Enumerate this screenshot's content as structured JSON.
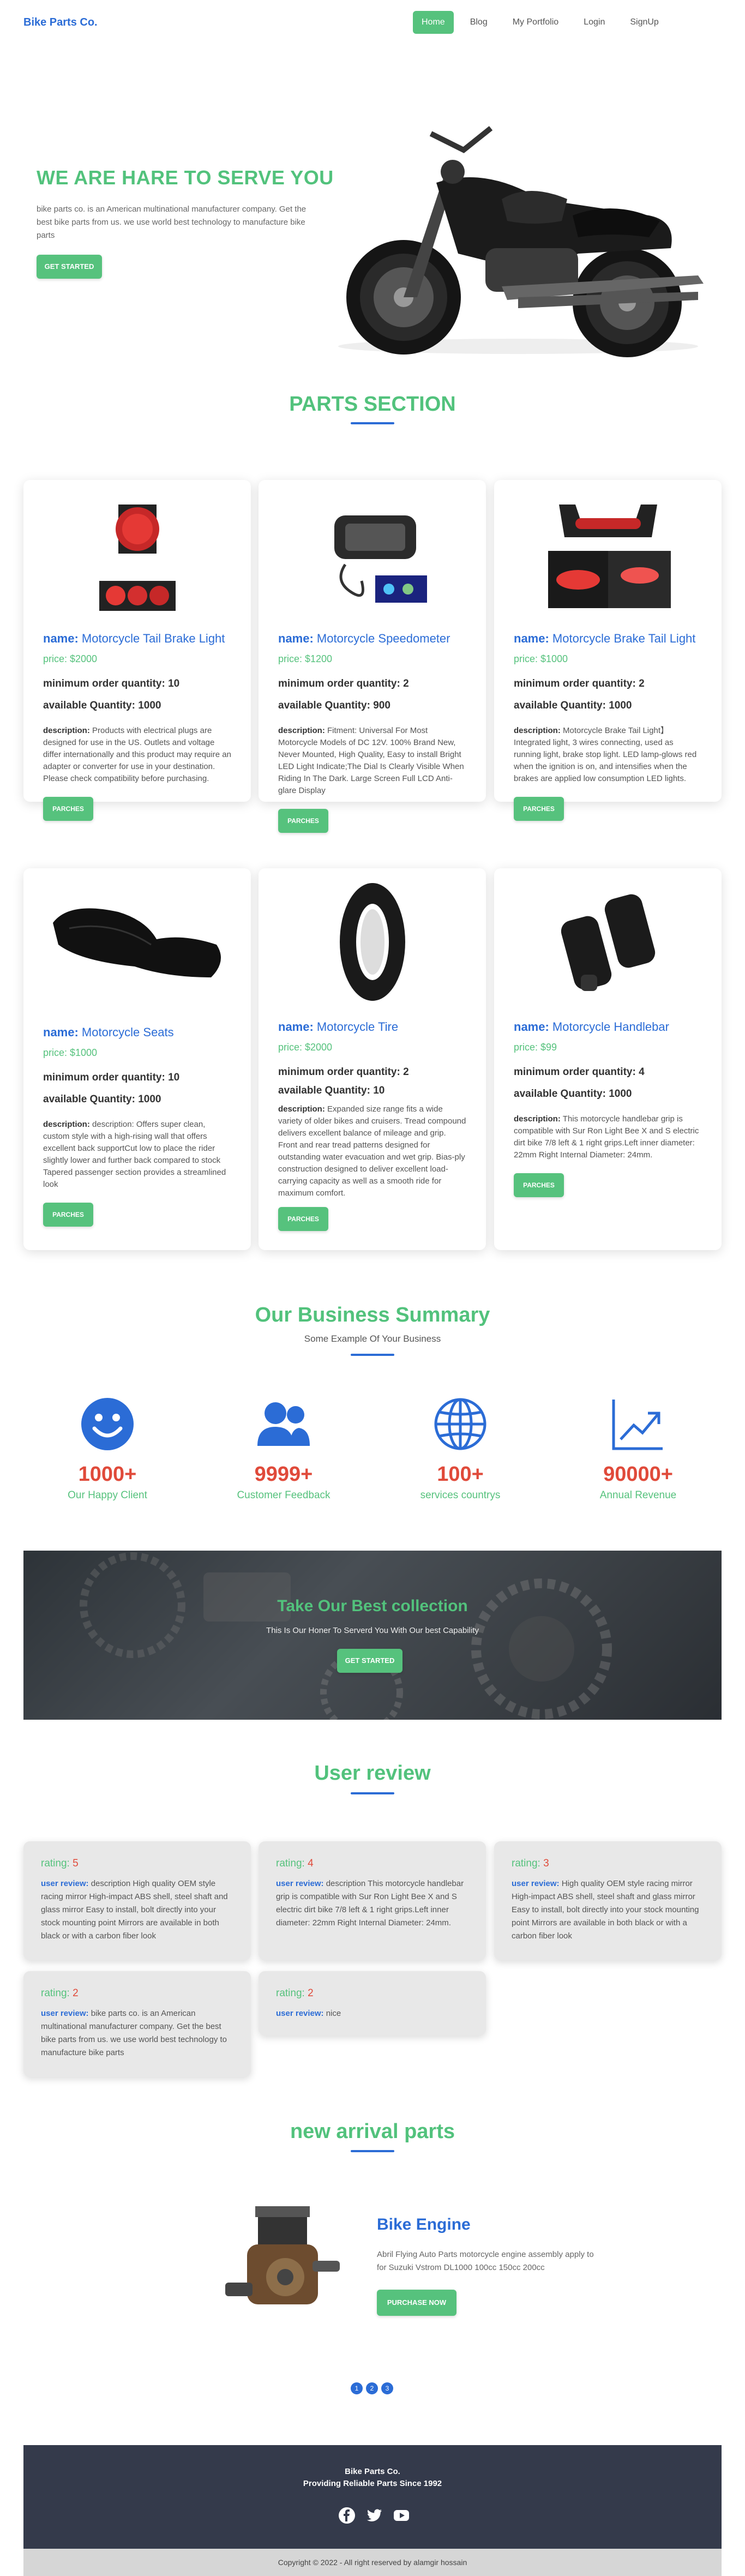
{
  "nav": {
    "brand": "Bike Parts Co.",
    "links": [
      "Home",
      "Blog",
      "My Portfolio",
      "Login",
      "SignUp"
    ]
  },
  "hero": {
    "title": "WE ARE HARE TO SERVE YOU",
    "text": "bike parts co. is an American multinational manufacturer company. Get the best bike parts from us. we use world best technology to manufacture bike parts",
    "button": "GET STARTED"
  },
  "parts": {
    "title": "PARTS SECTION",
    "name_label": "name:",
    "min_label": "minimum order quantity:",
    "avail_label": "available Quantity:",
    "desc_label": "description:",
    "button": "PARCHES",
    "items": [
      {
        "name": "Motorcycle Tail Brake Light",
        "price": "price: $2000",
        "min": "10",
        "avail": "1000",
        "desc": "Products with electrical plugs are designed for use in the US. Outlets and voltage differ internationally and this product may require an adapter or converter for use in your destination. Please check compatibility before purchasing."
      },
      {
        "name": "Motorcycle Speedometer",
        "price": "price: $1200",
        "min": "2",
        "avail": "900",
        "desc": "Fitment:  Universal For Most Motorcycle Models of DC 12V. 100% Brand New, Never Mounted, High Quality,  Easy to install Bright LED Light Indicate;The Dial Is Clearly Visible When Riding In The Dark. Large Screen Full LCD Anti-glare Display"
      },
      {
        "name": "Motorcycle Brake Tail Light",
        "price": "price: $1000",
        "min": "2",
        "avail": "1000",
        "desc": "Motorcycle Brake Tail Light】Integrated light, 3 wires connecting, used as running light, brake stop light. LED lamp-glows red when the ignition is on, and intensifies when the brakes are applied low consumption LED lights."
      },
      {
        "name": "Motorcycle Seats",
        "price": "price: $1000",
        "min": "10",
        "avail": "1000",
        "desc": "description: Offers super clean, custom style with a high-rising wall that offers excellent back supportCut low to place the rider slightly lower and further back compared to stock Tapered passenger section provides a streamlined look"
      },
      {
        "name": "Motorcycle Tire",
        "price": "price: $2000",
        "min": "2",
        "avail": "10",
        "desc": "Expanded size range fits a wide variety of older bikes and cruisers. Tread compound delivers excellent balance of mileage and grip. Front and rear tread patterns designed for outstanding water evacuation and wet grip. Bias-ply construction designed to deliver excellent load-carrying capacity as well as a smooth ride for maximum comfort."
      },
      {
        "name": "Motorcycle Handlebar",
        "price": "price: $99",
        "min": "4",
        "avail": "1000",
        "desc": "This motorcycle handlebar grip is compatible with Sur Ron Light Bee X and S electric dirt bike 7/8 left & 1 right grips.Left inner diameter: 22mm Right Internal Diameter: 24mm."
      }
    ]
  },
  "summary": {
    "title": "Our Business Summary",
    "subtitle": "Some Example Of Your Business",
    "stats": [
      {
        "num": "1000+",
        "label": "Our Happy Client",
        "icon": "smiley-icon"
      },
      {
        "num": "9999+",
        "label": "Customer Feedback",
        "icon": "users-icon"
      },
      {
        "num": "100+",
        "label": "services countrys",
        "icon": "globe-icon"
      },
      {
        "num": "90000+",
        "label": "Annual Revenue",
        "icon": "trending-up-icon"
      }
    ]
  },
  "banner": {
    "title": "Take Our Best collection",
    "text": "This Is Our Honer To Serverd You With Our best Capability",
    "button": "GET STARTED"
  },
  "reviews": {
    "title": "User review",
    "rating_label": "rating:",
    "review_label": "user review:",
    "items": [
      {
        "rating": "5",
        "text": "description High quality OEM style racing mirror High-impact ABS shell, steel shaft and glass mirror Easy to install, bolt directly into your stock mounting point Mirrors are available in both black or with a carbon fiber look"
      },
      {
        "rating": "4",
        "text": "description This motorcycle handlebar grip is compatible with Sur Ron Light Bee X and S electric dirt bike 7/8 left & 1 right grips.Left inner diameter: 22mm Right Internal Diameter: 24mm."
      },
      {
        "rating": "3",
        "text": "High quality OEM style racing mirror High-impact ABS shell, steel shaft and glass mirror Easy to install, bolt directly into your stock mounting point Mirrors are available in both black or with a carbon fiber look"
      },
      {
        "rating": "2",
        "text": "bike parts co. is an American multinational manufacturer company. Get the best bike parts from us. we use world best technology to manufacture bike parts"
      },
      {
        "rating": "2",
        "text": "nice"
      }
    ]
  },
  "arrival": {
    "title": "new arrival parts",
    "item_title": "Bike Engine",
    "item_text": "Abril Flying Auto Parts motorcycle engine assembly apply to for Suzuki Vstrom DL1000 100cc 150cc 200cc",
    "button": "PURCHASE NOW"
  },
  "pager": [
    "1",
    "2",
    "3"
  ],
  "footer": {
    "name": "Bike Parts Co.",
    "tagline": "Providing Reliable Parts Since 1992",
    "copyright": "Copyright © 2022 - All right reserved by alamgir hossain"
  },
  "colors": {
    "accent": "#56c27d",
    "link": "#2b6cd6",
    "stat": "#e04a3a",
    "footer": "#343a4b"
  }
}
